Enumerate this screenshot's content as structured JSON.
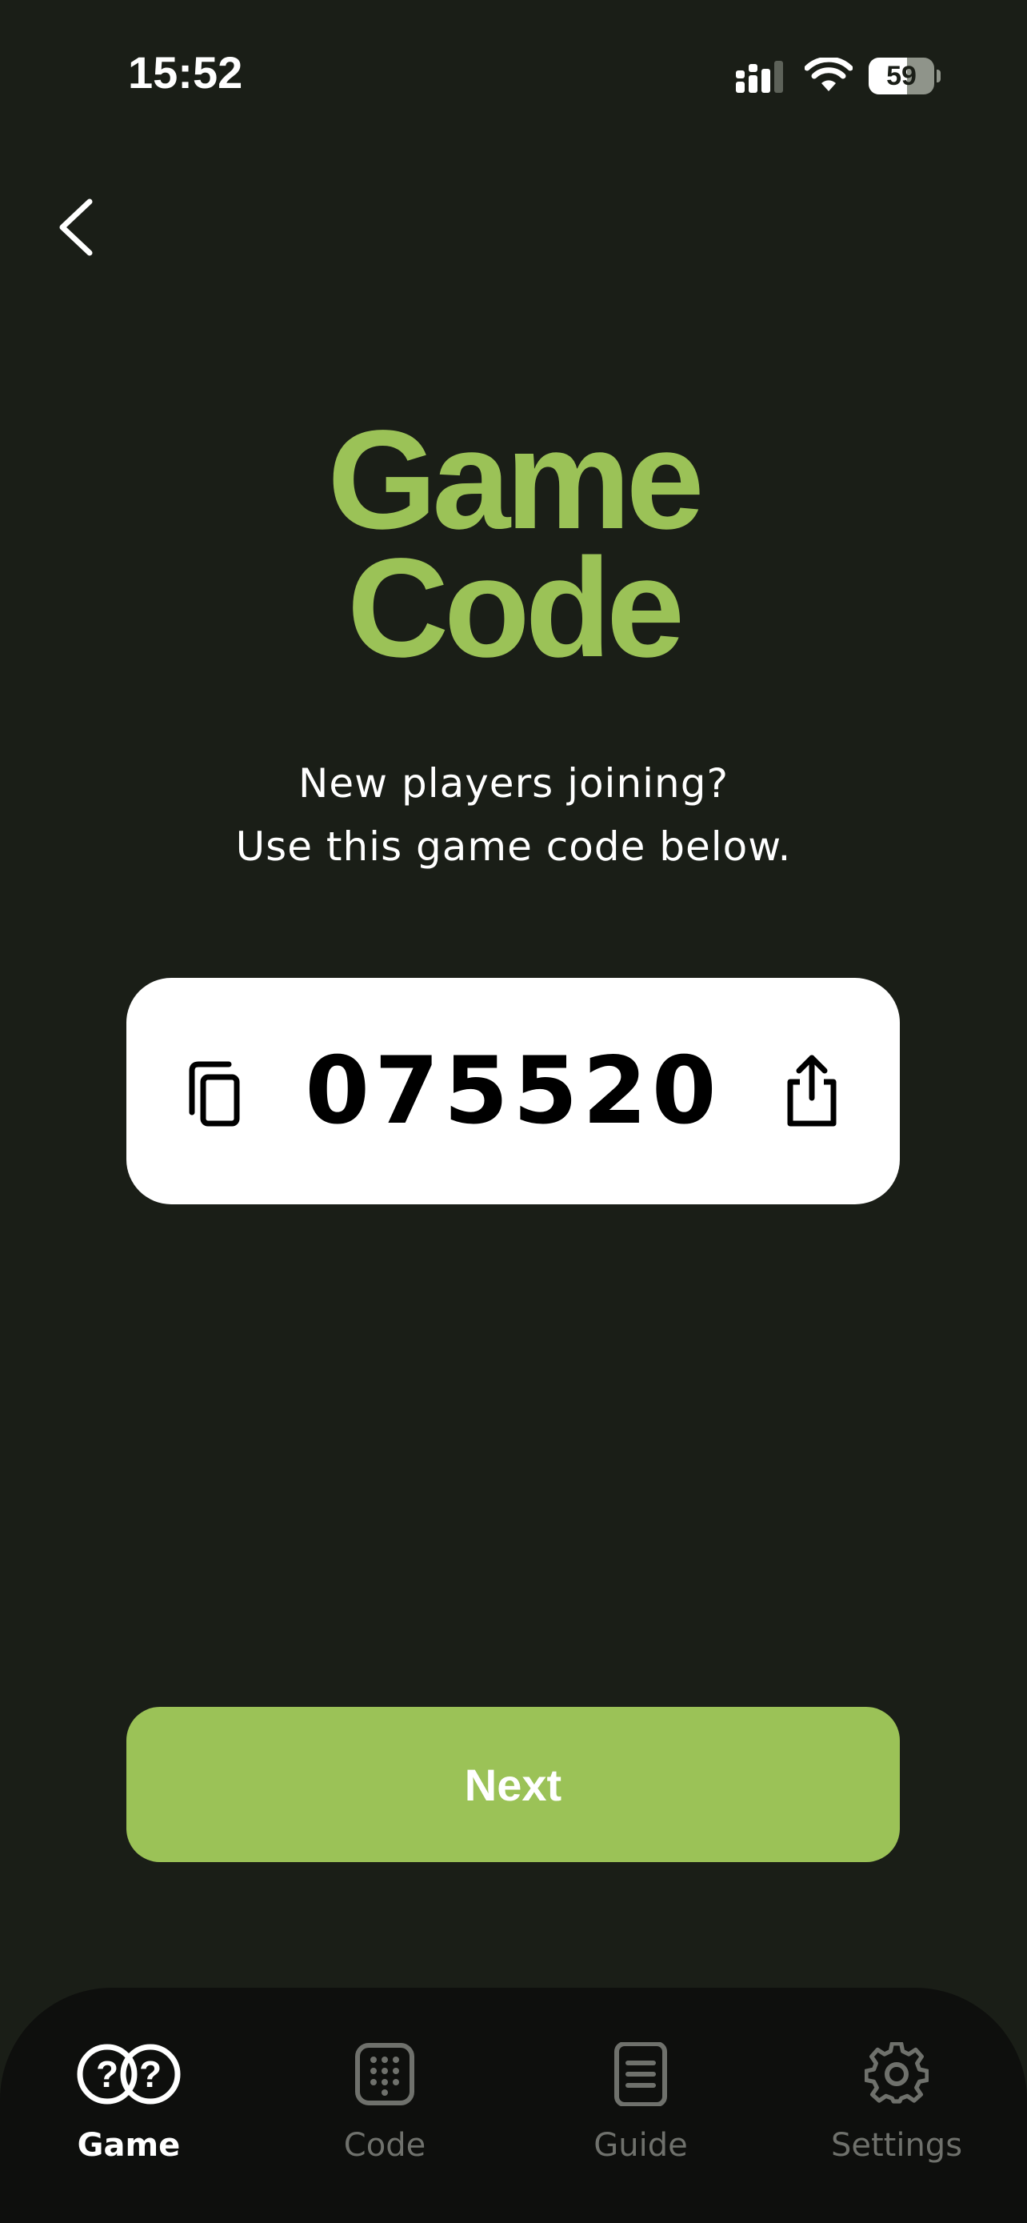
{
  "status_bar": {
    "time": "15:52",
    "battery_percent": "59",
    "battery_level": 0.59,
    "icons": [
      "signal-icon",
      "wifi-icon",
      "battery-icon"
    ]
  },
  "nav": {
    "back_icon": "chevron-left-icon"
  },
  "title": {
    "line1": "Game",
    "line2": "Code"
  },
  "subtitle": {
    "line1": "New players joining?",
    "line2": "Use this game code below."
  },
  "game_code": {
    "value": "075520",
    "copy_icon": "copy-icon",
    "share_icon": "share-icon"
  },
  "next_label": "Next",
  "tab_bar": {
    "tabs": [
      {
        "label": "Game",
        "icon": "game-icon",
        "active": true
      },
      {
        "label": "Code",
        "icon": "keypad-icon",
        "active": false
      },
      {
        "label": "Guide",
        "icon": "document-icon",
        "active": false
      },
      {
        "label": "Settings",
        "icon": "gear-icon",
        "active": false
      }
    ]
  },
  "colors": {
    "background": "#1a1e17",
    "accent": "#9bc257",
    "tab_bar": "#0e0f0d",
    "inactive_tab": "#6f716c",
    "card": "#ffffff"
  }
}
